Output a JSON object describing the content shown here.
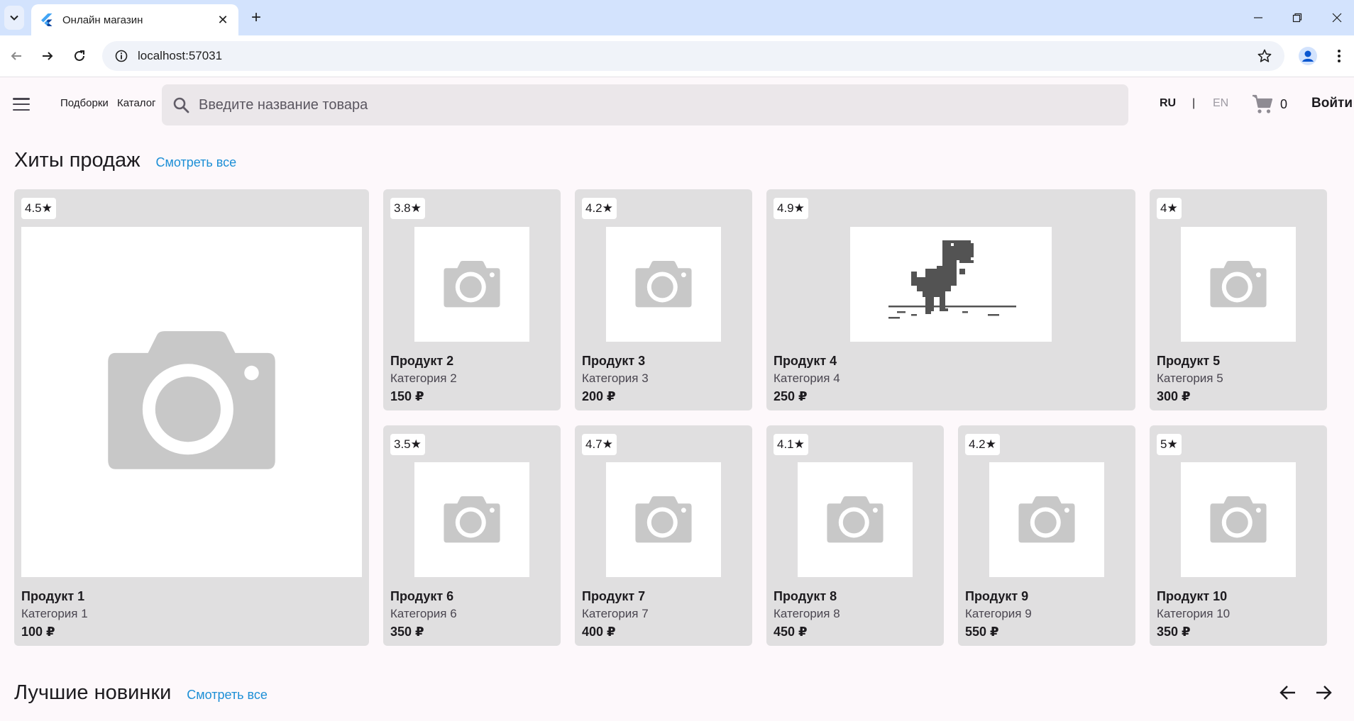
{
  "browser": {
    "tab_title": "Онлайн магазин",
    "url": "localhost:57031"
  },
  "header": {
    "nav": [
      "Подборки",
      "Каталог"
    ],
    "search_placeholder": "Введите название товара",
    "lang_ru": "RU",
    "lang_sep": "|",
    "lang_en": "EN",
    "cart_count": "0",
    "login": "Войти"
  },
  "sections": {
    "hits": {
      "title": "Хиты продаж",
      "see_all": "Смотреть все"
    },
    "new": {
      "title": "Лучшие новинки",
      "see_all": "Смотреть все"
    }
  },
  "products": [
    {
      "rating": "4.5★",
      "name": "Продукт 1",
      "category": "Категория 1",
      "price": "100 ₽",
      "image": "camera-placeholder"
    },
    {
      "rating": "3.8★",
      "name": "Продукт 2",
      "category": "Категория 2",
      "price": "150 ₽",
      "image": "camera-placeholder"
    },
    {
      "rating": "4.2★",
      "name": "Продукт 3",
      "category": "Категория 3",
      "price": "200 ₽",
      "image": "camera-placeholder"
    },
    {
      "rating": "4.9★",
      "name": "Продукт 4",
      "category": "Категория 4",
      "price": "250 ₽",
      "image": "dino-offline"
    },
    {
      "rating": "4★",
      "name": "Продукт 5",
      "category": "Категория 5",
      "price": "300 ₽",
      "image": "camera-placeholder"
    },
    {
      "rating": "3.5★",
      "name": "Продукт 6",
      "category": "Категория 6",
      "price": "350 ₽",
      "image": "camera-placeholder"
    },
    {
      "rating": "4.7★",
      "name": "Продукт 7",
      "category": "Категория 7",
      "price": "400 ₽",
      "image": "camera-placeholder"
    },
    {
      "rating": "4.1★",
      "name": "Продукт 8",
      "category": "Категория 8",
      "price": "450 ₽",
      "image": "camera-placeholder"
    },
    {
      "rating": "4.2★",
      "name": "Продукт 9",
      "category": "Категория 9",
      "price": "550 ₽",
      "image": "camera-placeholder"
    },
    {
      "rating": "5★",
      "name": "Продукт 10",
      "category": "Категория 10",
      "price": "350 ₽",
      "image": "camera-placeholder"
    }
  ],
  "colors": {
    "tabbar": "#d3e3fd",
    "page_bg": "#fdf8fb",
    "card_bg": "#e0dfe0",
    "link": "#1d8fd6",
    "placeholder_icon": "#c8c8c8"
  }
}
